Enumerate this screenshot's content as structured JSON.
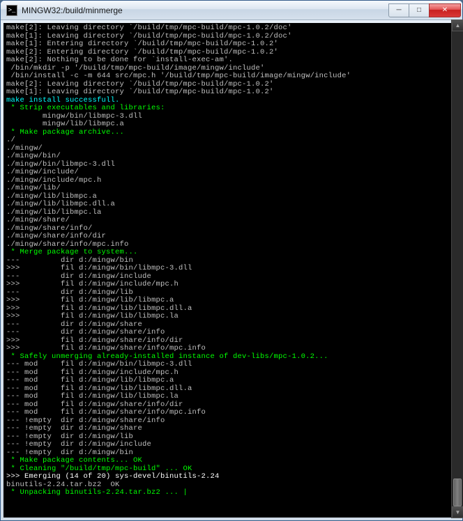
{
  "window": {
    "title": "MINGW32:/build/minmerge"
  },
  "controls": {
    "minimize": "─",
    "maximize": "□",
    "close": "✕"
  },
  "terminal_lines": [
    {
      "cls": "gray",
      "t": "make[2]: Leaving directory `/build/tmp/mpc-build/mpc-1.0.2/doc'"
    },
    {
      "cls": "gray",
      "t": "make[1]: Leaving directory `/build/tmp/mpc-build/mpc-1.0.2/doc'"
    },
    {
      "cls": "gray",
      "t": "make[1]: Entering directory `/build/tmp/mpc-build/mpc-1.0.2'"
    },
    {
      "cls": "gray",
      "t": "make[2]: Entering directory `/build/tmp/mpc-build/mpc-1.0.2'"
    },
    {
      "cls": "gray",
      "t": "make[2]: Nothing to be done for `install-exec-am'."
    },
    {
      "cls": "gray",
      "t": " /bin/mkdir -p '/build/tmp/mpc-build/image/mingw/include'"
    },
    {
      "cls": "gray",
      "t": " /bin/install -c -m 644 src/mpc.h '/build/tmp/mpc-build/image/mingw/include'"
    },
    {
      "cls": "gray",
      "t": "make[2]: Leaving directory `/build/tmp/mpc-build/mpc-1.0.2'"
    },
    {
      "cls": "gray",
      "t": "make[1]: Leaving directory `/build/tmp/mpc-build/mpc-1.0.2'"
    },
    {
      "cls": "cyan",
      "t": "make install successfull."
    },
    {
      "cls": "green",
      "t": " * Strip executables and libraries:"
    },
    {
      "cls": "gray",
      "t": "        mingw/bin/libmpc-3.dll"
    },
    {
      "cls": "gray",
      "t": "        mingw/lib/libmpc.a"
    },
    {
      "cls": "green",
      "t": " * Make package archive..."
    },
    {
      "cls": "gray",
      "t": "./"
    },
    {
      "cls": "gray",
      "t": "./mingw/"
    },
    {
      "cls": "gray",
      "t": "./mingw/bin/"
    },
    {
      "cls": "gray",
      "t": "./mingw/bin/libmpc-3.dll"
    },
    {
      "cls": "gray",
      "t": "./mingw/include/"
    },
    {
      "cls": "gray",
      "t": "./mingw/include/mpc.h"
    },
    {
      "cls": "gray",
      "t": "./mingw/lib/"
    },
    {
      "cls": "gray",
      "t": "./mingw/lib/libmpc.a"
    },
    {
      "cls": "gray",
      "t": "./mingw/lib/libmpc.dll.a"
    },
    {
      "cls": "gray",
      "t": "./mingw/lib/libmpc.la"
    },
    {
      "cls": "gray",
      "t": "./mingw/share/"
    },
    {
      "cls": "gray",
      "t": "./mingw/share/info/"
    },
    {
      "cls": "gray",
      "t": "./mingw/share/info/dir"
    },
    {
      "cls": "gray",
      "t": "./mingw/share/info/mpc.info"
    },
    {
      "cls": "green",
      "t": " * Merge package to system..."
    },
    {
      "cls": "gray",
      "t": "---         dir d:/mingw/bin"
    },
    {
      "cls": "gray",
      "t": ">>>         fil d:/mingw/bin/libmpc-3.dll"
    },
    {
      "cls": "gray",
      "t": "---         dir d:/mingw/include"
    },
    {
      "cls": "gray",
      "t": ">>>         fil d:/mingw/include/mpc.h"
    },
    {
      "cls": "gray",
      "t": "---         dir d:/mingw/lib"
    },
    {
      "cls": "gray",
      "t": ">>>         fil d:/mingw/lib/libmpc.a"
    },
    {
      "cls": "gray",
      "t": ">>>         fil d:/mingw/lib/libmpc.dll.a"
    },
    {
      "cls": "gray",
      "t": ">>>         fil d:/mingw/lib/libmpc.la"
    },
    {
      "cls": "gray",
      "t": "---         dir d:/mingw/share"
    },
    {
      "cls": "gray",
      "t": "---         dir d:/mingw/share/info"
    },
    {
      "cls": "gray",
      "t": ">>>         fil d:/mingw/share/info/dir"
    },
    {
      "cls": "gray",
      "t": ">>>         fil d:/mingw/share/info/mpc.info"
    },
    {
      "cls": "green",
      "t": " * Safely unmerging already-installed instance of dev-libs/mpc-1.0.2..."
    },
    {
      "cls": "gray",
      "t": "--- mod     fil d:/mingw/bin/libmpc-3.dll"
    },
    {
      "cls": "gray",
      "t": "--- mod     fil d:/mingw/include/mpc.h"
    },
    {
      "cls": "gray",
      "t": "--- mod     fil d:/mingw/lib/libmpc.a"
    },
    {
      "cls": "gray",
      "t": "--- mod     fil d:/mingw/lib/libmpc.dll.a"
    },
    {
      "cls": "gray",
      "t": "--- mod     fil d:/mingw/lib/libmpc.la"
    },
    {
      "cls": "gray",
      "t": "--- mod     fil d:/mingw/share/info/dir"
    },
    {
      "cls": "gray",
      "t": "--- mod     fil d:/mingw/share/info/mpc.info"
    },
    {
      "cls": "gray",
      "t": "--- !empty  dir d:/mingw/share/info"
    },
    {
      "cls": "gray",
      "t": "--- !empty  dir d:/mingw/share"
    },
    {
      "cls": "gray",
      "t": "--- !empty  dir d:/mingw/lib"
    },
    {
      "cls": "gray",
      "t": "--- !empty  dir d:/mingw/include"
    },
    {
      "cls": "gray",
      "t": "--- !empty  dir d:/mingw/bin"
    },
    {
      "cls": "green",
      "t": " * Make package contents... OK"
    },
    {
      "cls": "green",
      "t": " * Cleaning \"/build/tmp/mpc-build\" ... OK"
    },
    {
      "cls": "white-bright",
      "t": ">>> Emerging (14 of 20) sys-devel/binutils-2.24"
    },
    {
      "cls": "gray",
      "t": "binutils-2.24.tar.bz2  OK"
    },
    {
      "cls": "green",
      "t": " * Unpacking binutils-2.24.tar.bz2 ... |"
    }
  ]
}
